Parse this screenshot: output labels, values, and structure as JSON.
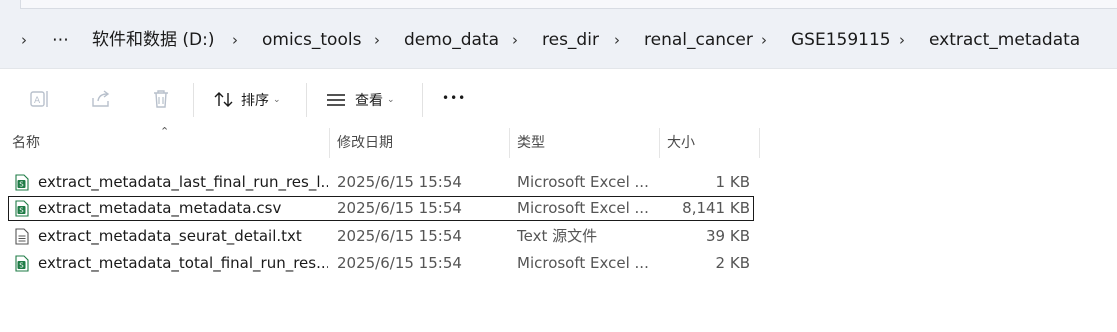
{
  "address_bar": {
    "crumbs": [
      "软件和数据 (D:)",
      "omics_tools",
      "demo_data",
      "res_dir",
      "renal_cancer",
      "GSE159115",
      "extract_metadata"
    ],
    "overflow": "⋯"
  },
  "toolbar": {
    "sort_label": "排序",
    "view_label": "查看",
    "more_label": "•••"
  },
  "columns": {
    "name": "名称",
    "date": "修改日期",
    "type": "类型",
    "size": "大小"
  },
  "files": [
    {
      "name": "extract_metadata_last_final_run_res_l...",
      "date": "2025/6/15 15:54",
      "type": "Microsoft Excel ...",
      "size": "1 KB",
      "icon": "excel-csv-icon"
    },
    {
      "name": "extract_metadata_metadata.csv",
      "date": "2025/6/15 15:54",
      "type": "Microsoft Excel ...",
      "size": "8,141 KB",
      "icon": "excel-csv-icon"
    },
    {
      "name": "extract_metadata_seurat_detail.txt",
      "date": "2025/6/15 15:54",
      "type": "Text 源文件",
      "size": "39 KB",
      "icon": "text-file-icon"
    },
    {
      "name": "extract_metadata_total_final_run_res...",
      "date": "2025/6/15 15:54",
      "type": "Microsoft Excel ...",
      "size": "2 KB",
      "icon": "excel-csv-icon"
    }
  ],
  "colors": {
    "address_bg": "#eef1f6",
    "excel_green": "#1e7b45",
    "selection_border": "#1a1a1a"
  }
}
